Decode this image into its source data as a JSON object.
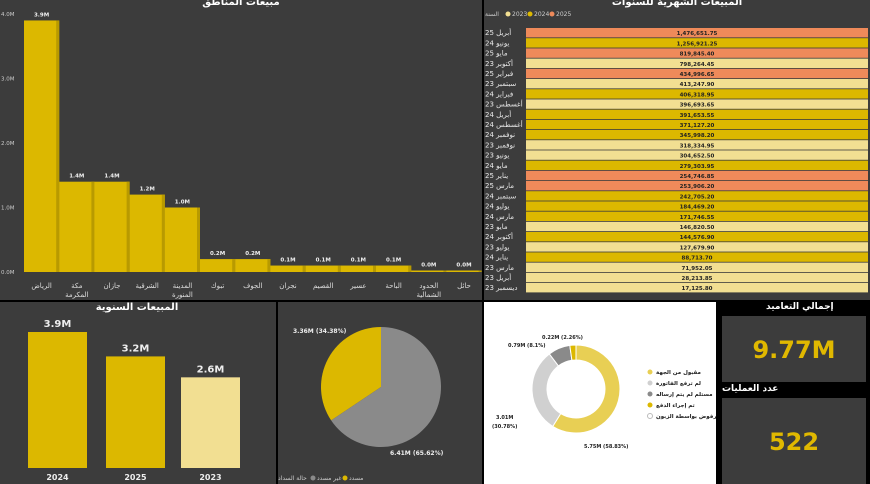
{
  "colors": {
    "y2023": "#f2df92",
    "y2024": "#dcb800",
    "y2025": "#ef8a5a",
    "dark_panel": "#3c3c3c",
    "gray": "#8a8a8a",
    "light_gray": "#d0d0d0",
    "yellow": "#e8cf54",
    "kpi_value": "#e0b800"
  },
  "region_chart": {
    "title": "مبيعات المناطق",
    "y_ticks": [
      "0.0M",
      "1.0M",
      "2.0M",
      "3.0M",
      "4.0M"
    ],
    "bar_color": "#dcb800"
  },
  "monthly_chart": {
    "title": "المبيعات الشهرية للسنوات",
    "legend_label": "السنة",
    "legend": [
      {
        "name": "2023",
        "color": "#f2df92"
      },
      {
        "name": "2024",
        "color": "#dcb800"
      },
      {
        "name": "2025",
        "color": "#ef8a5a"
      }
    ]
  },
  "yearly_chart": {
    "title": "المبيعات السنوية"
  },
  "pie_chart": {
    "legend_title": "حالة السداد",
    "legend": [
      {
        "name": "مسدد",
        "color": "#dcb800"
      },
      {
        "name": "غير مسدد",
        "color": "#8a8a8a"
      }
    ]
  },
  "donut_chart": {
    "legend": [
      {
        "name": "مقبول من الجهة",
        "color": "#e8cf54"
      },
      {
        "name": "لم ترفع الفاتورة",
        "color": "#d0d0d0"
      },
      {
        "name": "مستلم لم يتم إرساله",
        "color": "#8a8a8a"
      },
      {
        "name": "تم إجراء الدفع",
        "color": "#dcb800"
      },
      {
        "name": "مرفوض بواسطة الزبون",
        "color": "#ffffff"
      }
    ]
  },
  "kpis": {
    "total_label": "إجمالي التعاميد",
    "total_value": "9.77M",
    "count_label": "عدد العمليات",
    "count_value": "522"
  },
  "chart_data": [
    {
      "type": "bar",
      "title": "مبيعات المناطق",
      "categories": [
        "الرياض",
        "مكة المكرمة",
        "جازان",
        "الشرقية",
        "المدينة المنورة",
        "تبوك",
        "الجوف",
        "نجران",
        "القصيم",
        "عسير",
        "الباحة",
        "الحدود الشمالية",
        "حائل"
      ],
      "values": [
        3.9,
        1.4,
        1.4,
        1.2,
        1.0,
        0.2,
        0.2,
        0.1,
        0.1,
        0.1,
        0.1,
        0.0,
        0.0
      ],
      "data_labels": [
        "3.9M",
        "1.4M",
        "1.4M",
        "1.2M",
        "1.0M",
        "0.2M",
        "0.2M",
        "0.1M",
        "0.1M",
        "0.1M",
        "0.1M",
        "0.0M",
        "0.0M"
      ],
      "ylim": [
        0,
        4
      ],
      "grid": false
    },
    {
      "type": "bar",
      "title": "المبيعات الشهرية للسنوات",
      "orientation": "horizontal",
      "legend_title": "السنة",
      "legend_placement": "top-right",
      "rows": [
        {
          "label": "أبريل 25",
          "year": "2025",
          "value": "1,476,651.75"
        },
        {
          "label": "يونيو 24",
          "year": "2024",
          "value": "1,256,921.25"
        },
        {
          "label": "مايو 25",
          "year": "2025",
          "value": "819,845.40"
        },
        {
          "label": "أكتوبر 23",
          "year": "2023",
          "value": "798,264.45"
        },
        {
          "label": "فبراير 25",
          "year": "2025",
          "value": "434,996.65"
        },
        {
          "label": "سبتمبر 23",
          "year": "2023",
          "value": "413,247.90"
        },
        {
          "label": "فبراير 24",
          "year": "2024",
          "value": "406,318.95"
        },
        {
          "label": "أغسطس 23",
          "year": "2023",
          "value": "396,693.65"
        },
        {
          "label": "أبريل 24",
          "year": "2024",
          "value": "391,653.55"
        },
        {
          "label": "أغسطس 24",
          "year": "2024",
          "value": "371,127.20"
        },
        {
          "label": "نوفمبر 24",
          "year": "2024",
          "value": "345,998.20"
        },
        {
          "label": "نوفمبر 23",
          "year": "2023",
          "value": "318,334.95"
        },
        {
          "label": "يونيو 23",
          "year": "2023",
          "value": "304,652.50"
        },
        {
          "label": "مايو 24",
          "year": "2024",
          "value": "279,303.95"
        },
        {
          "label": "يناير 25",
          "year": "2025",
          "value": "254,746.85"
        },
        {
          "label": "مارس 25",
          "year": "2025",
          "value": "253,906.20"
        },
        {
          "label": "سبتمبر 24",
          "year": "2024",
          "value": "242,705.20"
        },
        {
          "label": "يوليو 24",
          "year": "2024",
          "value": "184,469.20"
        },
        {
          "label": "مارس 24",
          "year": "2024",
          "value": "171,746.55"
        },
        {
          "label": "مايو 23",
          "year": "2023",
          "value": "146,820.50"
        },
        {
          "label": "أكتوبر 24",
          "year": "2024",
          "value": "144,576.90"
        },
        {
          "label": "يوليو 23",
          "year": "2023",
          "value": "127,679.90"
        },
        {
          "label": "يناير 24",
          "year": "2024",
          "value": "88,713.70"
        },
        {
          "label": "مارس 23",
          "year": "2023",
          "value": "71,952.05"
        },
        {
          "label": "أبريل 23",
          "year": "2023",
          "value": "28,213.85"
        },
        {
          "label": "ديسمبر 23",
          "year": "2023",
          "value": "17,125.80"
        }
      ]
    },
    {
      "type": "bar",
      "title": "المبيعات السنوية",
      "categories": [
        "2024",
        "2025",
        "2023"
      ],
      "values": [
        3.9,
        3.2,
        2.6
      ],
      "data_labels": [
        "3.9M",
        "3.2M",
        "2.6M"
      ],
      "colors": [
        "#dcb800",
        "#dcb800",
        "#f2df92"
      ]
    },
    {
      "type": "pie",
      "legend_title": "حالة السداد",
      "slices": [
        {
          "name": "مسدد",
          "value": 3.36,
          "label": "3.36M (34.38%)",
          "color": "#dcb800"
        },
        {
          "name": "غير مسدد",
          "value": 6.41,
          "label": "6.41M (65.62%)",
          "color": "#8a8a8a"
        }
      ]
    },
    {
      "type": "pie",
      "donut": true,
      "slices": [
        {
          "name": "مقبول من الجهة",
          "value": 5.75,
          "label": "5.75M (58.83%)",
          "color": "#e8cf54"
        },
        {
          "name": "لم ترفع الفاتورة",
          "value": 3.01,
          "label": "3.01M (30.78%)",
          "color": "#d0d0d0"
        },
        {
          "name": "مستلم لم يتم إرساله",
          "value": 0.79,
          "label": "0.79M (8.1%)",
          "color": "#8a8a8a"
        },
        {
          "name": "تم إجراء الدفع",
          "value": 0.22,
          "label": "0.22M (2.26%)",
          "color": "#dcb800"
        }
      ]
    }
  ]
}
